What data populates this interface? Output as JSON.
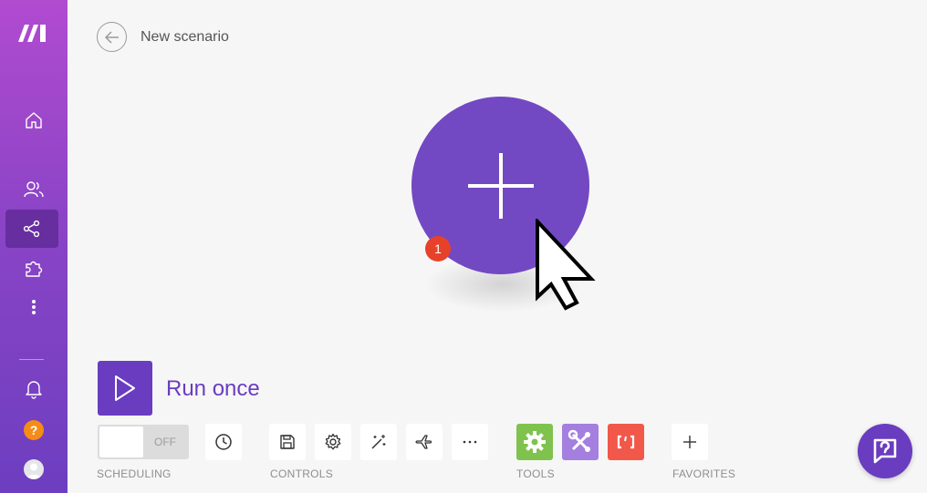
{
  "header": {
    "title": "New scenario"
  },
  "canvas": {
    "module_badge": "1"
  },
  "run": {
    "label": "Run once"
  },
  "scheduling": {
    "toggle_state": "OFF",
    "section_label": "SCHEDULING"
  },
  "controls": {
    "section_label": "CONTROLS"
  },
  "tools": {
    "section_label": "TOOLS"
  },
  "favorites": {
    "section_label": "FAVORITES"
  },
  "sidebar": {
    "help_label": "?"
  },
  "colors": {
    "accent": "#6a3cc0",
    "module": "#7249c2",
    "badge": "#e8412a",
    "tool_green": "#7fc24d",
    "tool_purple": "#a47fe0",
    "tool_orange": "#f1584a"
  }
}
